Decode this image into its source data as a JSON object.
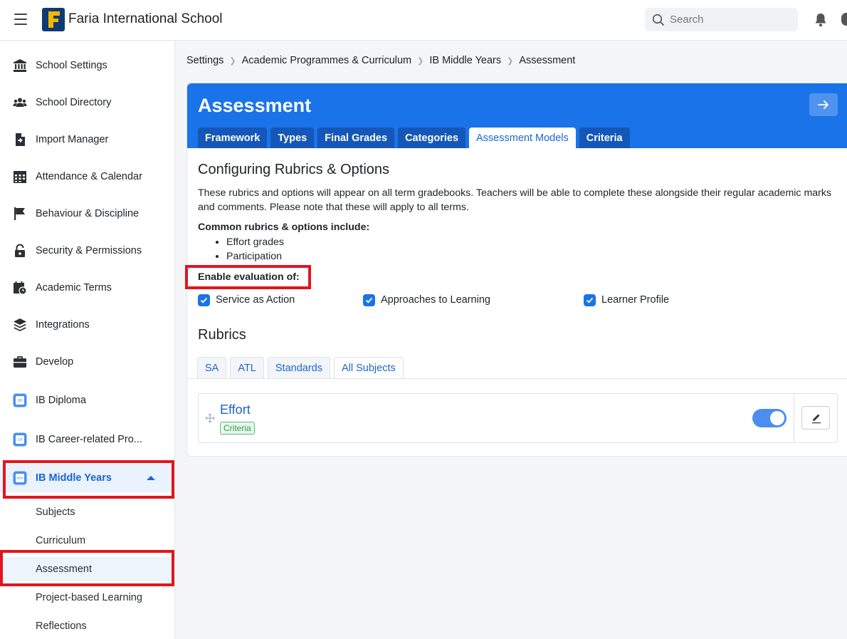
{
  "topbar": {
    "school_name": "Faria International School",
    "search_placeholder": "Search",
    "colors": {
      "logo_bg": "#0f3a73",
      "logo_letter": "#f5b800"
    }
  },
  "sidebar": {
    "items": [
      {
        "label": "School Settings",
        "icon": "bank-icon"
      },
      {
        "label": "School Directory",
        "icon": "people-icon"
      },
      {
        "label": "Import Manager",
        "icon": "file-import-icon"
      },
      {
        "label": "Attendance & Calendar",
        "icon": "calendar-grid-icon"
      },
      {
        "label": "Behaviour & Discipline",
        "icon": "flag-icon"
      },
      {
        "label": "Security & Permissions",
        "icon": "lock-icon"
      },
      {
        "label": "Academic Terms",
        "icon": "calendar-clock-icon"
      },
      {
        "label": "Integrations",
        "icon": "layers-icon"
      },
      {
        "label": "Develop",
        "icon": "briefcase-icon"
      },
      {
        "label": "IB Diploma",
        "icon": "ib-dp-icon"
      },
      {
        "label": "IB Career-related Pro...",
        "icon": "ib-cp-icon"
      },
      {
        "label": "IB Middle Years",
        "icon": "ib-myp-icon",
        "active": true
      }
    ],
    "subitems": [
      {
        "label": "Subjects"
      },
      {
        "label": "Curriculum"
      },
      {
        "label": "Assessment",
        "current": true
      },
      {
        "label": "Project-based Learning"
      },
      {
        "label": "Reflections"
      }
    ]
  },
  "breadcrumb": [
    "Settings",
    "Academic Programmes & Curriculum",
    "IB Middle Years",
    "Assessment"
  ],
  "card": {
    "title": "Assessment",
    "tabs": [
      {
        "label": "Framework"
      },
      {
        "label": "Types"
      },
      {
        "label": "Final Grades"
      },
      {
        "label": "Categories"
      },
      {
        "label": "Assessment Models",
        "active": true
      },
      {
        "label": "Criteria"
      }
    ],
    "section_title": "Configuring Rubrics & Options",
    "description": "These rubrics and options will appear on all term gradebooks. Teachers will be able to complete these alongside their regular academic marks and comments. Please note that these will apply to all terms.",
    "common_title": "Common rubrics & options include:",
    "common_items": [
      "Effort grades",
      "Participation"
    ],
    "enable_label": "Enable evaluation of:",
    "checkboxes": [
      {
        "label": "Service as Action",
        "checked": true
      },
      {
        "label": "Approaches to Learning",
        "checked": true
      },
      {
        "label": "Learner Profile",
        "checked": true
      }
    ],
    "rubrics_title": "Rubrics",
    "rubric_tabs": [
      {
        "label": "SA"
      },
      {
        "label": "ATL"
      },
      {
        "label": "Standards"
      },
      {
        "label": "All Subjects",
        "active": true
      }
    ],
    "rubric_rows": [
      {
        "name": "Effort",
        "badge": "Criteria",
        "enabled": true
      }
    ]
  },
  "colors": {
    "primary": "#1a73e8",
    "highlight_red": "#e0161e"
  }
}
